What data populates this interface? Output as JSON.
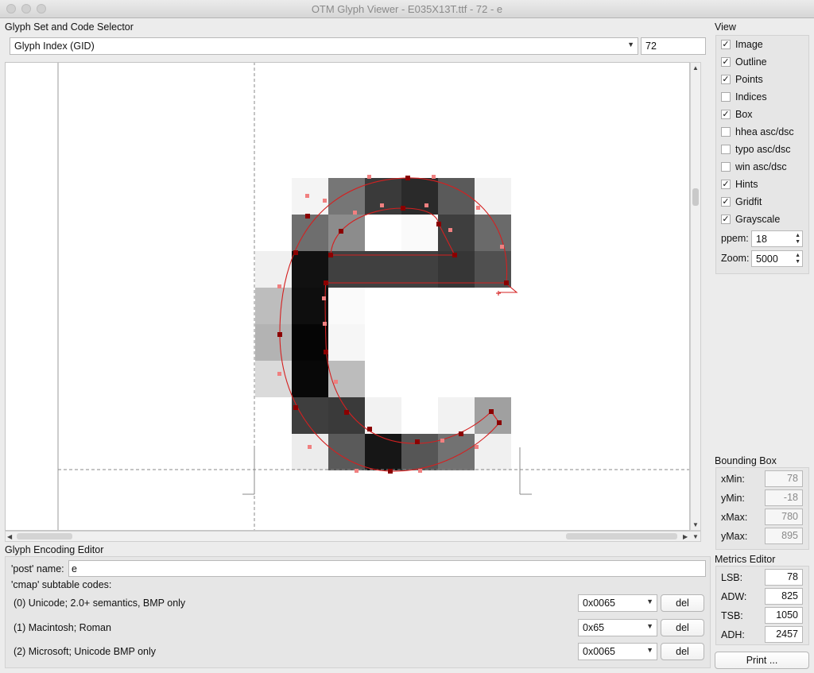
{
  "window": {
    "title": "OTM Glyph Viewer - E035X13T.ttf - 72 - e"
  },
  "selector": {
    "section_label": "Glyph Set and Code Selector",
    "mode_value": "Glyph Index (GID)",
    "glyph_value": "72"
  },
  "view": {
    "section_label": "View",
    "options": [
      {
        "label": "Image",
        "checked": true
      },
      {
        "label": "Outline",
        "checked": true
      },
      {
        "label": "Points",
        "checked": true
      },
      {
        "label": "Indices",
        "checked": false
      },
      {
        "label": "Box",
        "checked": true
      },
      {
        "label": "hhea asc/dsc",
        "checked": false
      },
      {
        "label": "typo asc/dsc",
        "checked": false
      },
      {
        "label": "win asc/dsc",
        "checked": false
      },
      {
        "label": "Hints",
        "checked": true
      },
      {
        "label": "Gridfit",
        "checked": true
      },
      {
        "label": "Grayscale",
        "checked": true
      }
    ],
    "ppem_label": "ppem:",
    "ppem_value": "18",
    "zoom_label": "Zoom:",
    "zoom_value": "5000"
  },
  "bbox": {
    "section_label": "Bounding Box",
    "rows": [
      {
        "label": "xMin:",
        "value": "78"
      },
      {
        "label": "yMin:",
        "value": "-18"
      },
      {
        "label": "xMax:",
        "value": "780"
      },
      {
        "label": "yMax:",
        "value": "895"
      }
    ]
  },
  "encoding": {
    "section_label": "Glyph Encoding Editor",
    "post_label": "'post' name:",
    "post_value": "e",
    "cmap_label": "'cmap' subtable codes:",
    "rows": [
      {
        "label": "(0) Unicode; 2.0+ semantics, BMP only",
        "code": "0x0065",
        "del": "del"
      },
      {
        "label": "(1) Macintosh; Roman",
        "code": "0x65",
        "del": "del"
      },
      {
        "label": "(2) Microsoft; Unicode BMP only",
        "code": "0x0065",
        "del": "del"
      }
    ]
  },
  "metrics": {
    "section_label": "Metrics Editor",
    "rows": [
      {
        "label": "LSB:",
        "value": "78"
      },
      {
        "label": "ADW:",
        "value": "825"
      },
      {
        "label": "TSB:",
        "value": "1050"
      },
      {
        "label": "ADH:",
        "value": "2457"
      }
    ],
    "print_label": "Print ..."
  },
  "colors": {
    "outline": "#d42020",
    "on_point": "#8b0000",
    "off_point": "#f08080",
    "background": "#ececec"
  }
}
